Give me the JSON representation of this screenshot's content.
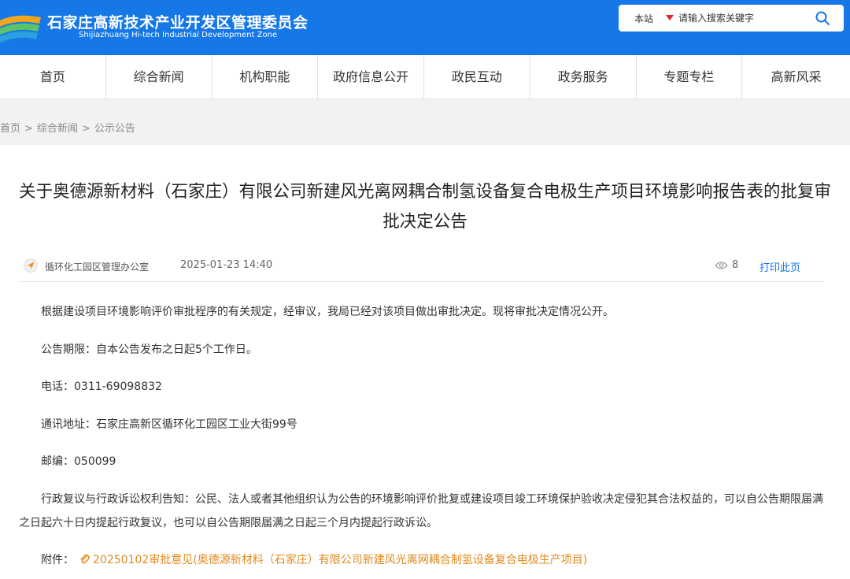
{
  "header": {
    "title": "石家庄高新技术产业开发区管理委员会",
    "subtitle": "Shijiazhuang Hi-tech Industrial Development Zone",
    "accent_color": "#1677e6",
    "logo_icon": "wave-logo-icon"
  },
  "search": {
    "scope": "本站",
    "placeholder": "请输入搜索关键字",
    "button_icon": "search-icon"
  },
  "nav": {
    "items": [
      "首页",
      "综合新闻",
      "机构职能",
      "政府信息公开",
      "政民互动",
      "政务服务",
      "专题专栏",
      "高新风采"
    ]
  },
  "breadcrumb": {
    "items": [
      "首页",
      "综合新闻",
      "公示公告"
    ],
    "separator": ">"
  },
  "article": {
    "title": "关于奥德源新材料（石家庄）有限公司新建风光离网耦合制氢设备复合电极生产项目环境影响报告表的批复审批决定公告",
    "source": "循环化工园区管理办公室",
    "date": "2025-01-23 14:40",
    "views": "8",
    "print_label": "打印此页",
    "paragraphs": [
      "根据建设项目环境影响评价审批程序的有关规定，经审议，我局已经对该项目做出审批决定。现将审批决定情况公开。",
      "公告期限：自本公告发布之日起5个工作日。",
      "电话：0311-69098832",
      "通讯地址：石家庄高新区循环化工园区工业大街99号",
      "邮编：050099",
      "行政复议与行政诉讼权利告知：公民、法人或者其他组织认为公告的环境影响评价批复或建设项目竣工环境保护验收决定侵犯其合法权益的，可以自公告期限届满之日起六十日内提起行政复议，也可以自公告期限届满之日起三个月内提起行政诉讼。"
    ],
    "attachment_label": "附件：",
    "attachment_name": "20250102审批意见(奥德源新材料（石家庄）有限公司新建风光离网耦合制氢设备复合电极生产项目)"
  }
}
